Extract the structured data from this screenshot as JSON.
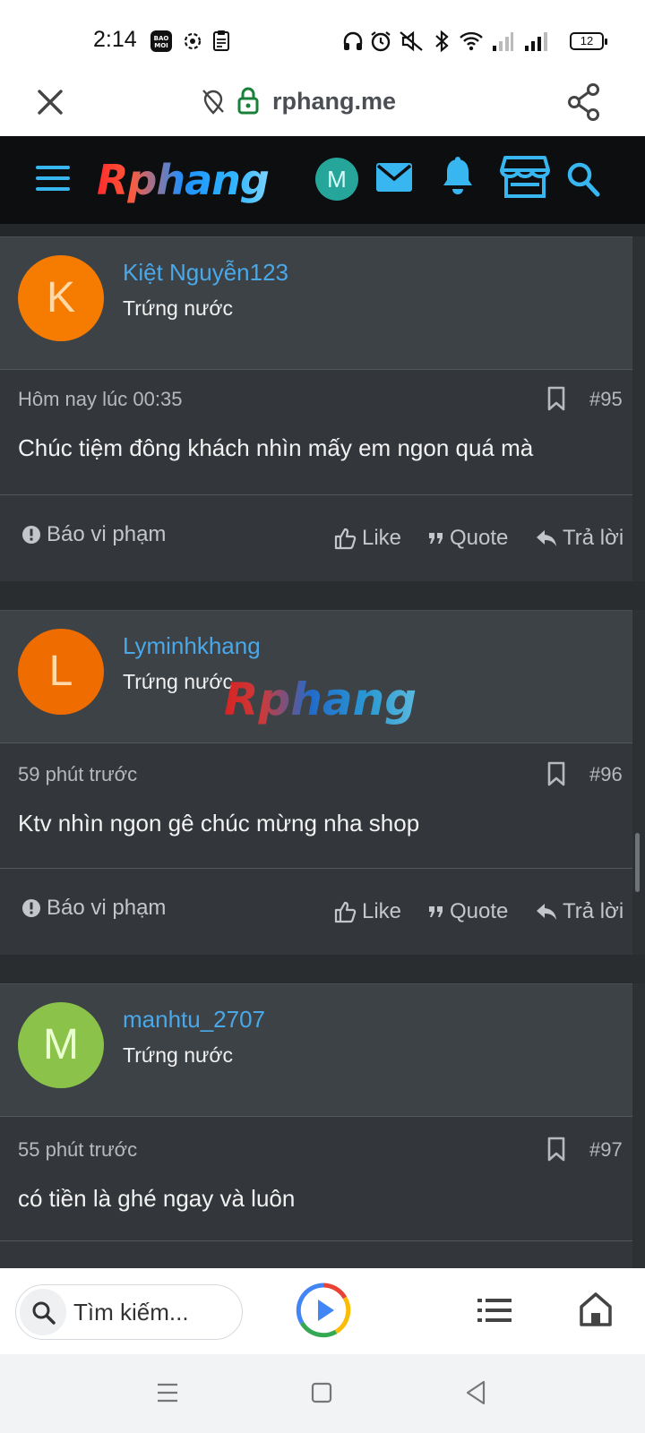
{
  "status_bar": {
    "time": "2:14",
    "battery": "12",
    "left_icons": [
      "bao-moi-icon",
      "settings-sync-icon",
      "clipboard-icon"
    ],
    "right_icons": [
      "headphones-icon",
      "alarm-icon",
      "mute-icon",
      "bluetooth-icon",
      "wifi-icon",
      "signal-icon",
      "signal-icon"
    ]
  },
  "browser": {
    "url": "rphang.me",
    "close_icon": "close-icon",
    "share_icon": "share-icon"
  },
  "site_header": {
    "brand": "Rphang",
    "user_initial": "M",
    "user_avatar_color": "#26a69a",
    "accent_color": "#38b6f0"
  },
  "posts": [
    {
      "username": "Kiệt Nguyễn123",
      "initial": "K",
      "avatar_color": "#f57c00",
      "rank": "Trứng nước",
      "time": "Hôm nay lúc 00:35",
      "number": "#95",
      "message": "Chúc tiệm đông khách nhìn mấy em ngon quá mà",
      "report": "Báo vi phạm",
      "like": "Like",
      "quote": "Quote",
      "reply": "Trả lời"
    },
    {
      "username": "Lyminhkhang",
      "initial": "L",
      "avatar_color": "#ef6c00",
      "rank": "Trứng nước",
      "time": "59 phút trước",
      "number": "#96",
      "message": "Ktv nhìn ngon gê chúc mừng nha shop",
      "report": "Báo vi phạm",
      "like": "Like",
      "quote": "Quote",
      "reply": "Trả lời"
    },
    {
      "username": "manhtu_2707",
      "initial": "M",
      "avatar_color": "#8bc34a",
      "rank": "Trứng nước",
      "time": "55 phút trước",
      "number": "#97",
      "message": "có tiền là ghé ngay và luôn"
    }
  ],
  "watermark": "Rphang",
  "bottom_bar": {
    "search_placeholder": "Tìm kiếm..."
  }
}
